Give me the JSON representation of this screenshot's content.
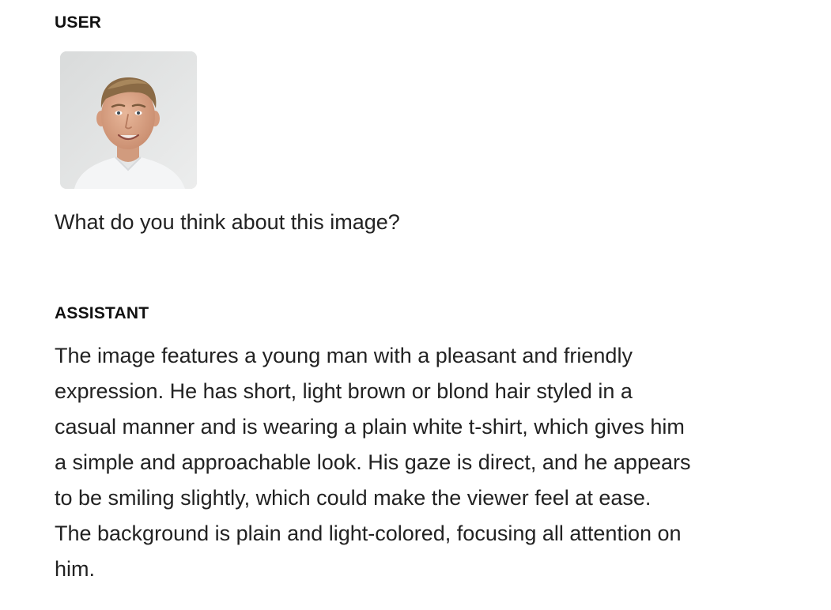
{
  "conversation": {
    "user": {
      "role_label": "USER",
      "image_alt": "portrait photo",
      "message": "What do you think about this image?"
    },
    "assistant": {
      "role_label": "ASSISTANT",
      "lines": [
        "The image features a young man with a pleasant and friendly",
        "expression. He has short, light brown or blond hair styled in a",
        "casual manner and is wearing a plain white t-shirt, which gives him",
        "a simple and approachable look. His gaze is direct, and he appears",
        "to be smiling slightly, which could make the viewer feel at ease.",
        "The background is plain and light-colored, focusing all attention on",
        "him."
      ]
    }
  }
}
